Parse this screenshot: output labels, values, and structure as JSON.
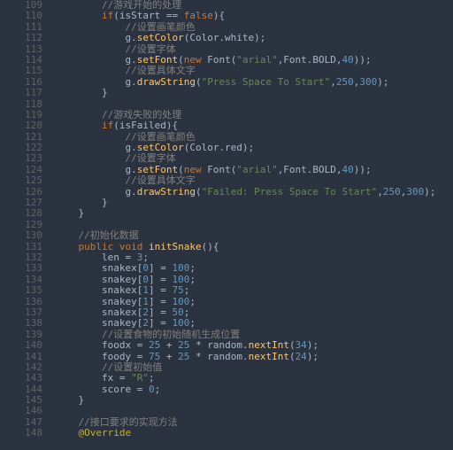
{
  "startLine": 109,
  "lines": [
    {
      "segs": [
        {
          "t": "        ",
          "c": "id"
        },
        {
          "t": "//游戏开始的处理",
          "c": "cm"
        }
      ]
    },
    {
      "segs": [
        {
          "t": "        ",
          "c": "id"
        },
        {
          "t": "if",
          "c": "kw"
        },
        {
          "t": "(isStart == ",
          "c": "id"
        },
        {
          "t": "false",
          "c": "kw"
        },
        {
          "t": "){",
          "c": "id"
        }
      ]
    },
    {
      "segs": [
        {
          "t": "            ",
          "c": "id"
        },
        {
          "t": "//设置画笔颜色",
          "c": "cm"
        }
      ]
    },
    {
      "segs": [
        {
          "t": "            g.",
          "c": "id"
        },
        {
          "t": "setColor",
          "c": "fn"
        },
        {
          "t": "(Color.white);",
          "c": "id"
        }
      ]
    },
    {
      "segs": [
        {
          "t": "            ",
          "c": "id"
        },
        {
          "t": "//设置字体",
          "c": "cm"
        }
      ]
    },
    {
      "segs": [
        {
          "t": "            g.",
          "c": "id"
        },
        {
          "t": "setFont",
          "c": "fn"
        },
        {
          "t": "(",
          "c": "id"
        },
        {
          "t": "new",
          "c": "kw"
        },
        {
          "t": " Font(",
          "c": "id"
        },
        {
          "t": "\"arial\"",
          "c": "str"
        },
        {
          "t": ",Font.BOLD,",
          "c": "id"
        },
        {
          "t": "40",
          "c": "num"
        },
        {
          "t": "));",
          "c": "id"
        }
      ]
    },
    {
      "segs": [
        {
          "t": "            ",
          "c": "id"
        },
        {
          "t": "//设置具体文字",
          "c": "cm"
        }
      ]
    },
    {
      "segs": [
        {
          "t": "            g.",
          "c": "id"
        },
        {
          "t": "drawString",
          "c": "fn"
        },
        {
          "t": "(",
          "c": "id"
        },
        {
          "t": "\"Press Space To Start\"",
          "c": "str"
        },
        {
          "t": ",",
          "c": "id"
        },
        {
          "t": "250",
          "c": "num"
        },
        {
          "t": ",",
          "c": "id"
        },
        {
          "t": "300",
          "c": "num"
        },
        {
          "t": ");",
          "c": "id"
        }
      ]
    },
    {
      "segs": [
        {
          "t": "        }",
          "c": "id"
        }
      ]
    },
    {
      "segs": [
        {
          "t": "",
          "c": "id"
        }
      ]
    },
    {
      "segs": [
        {
          "t": "        ",
          "c": "id"
        },
        {
          "t": "//游戏失败的处理",
          "c": "cm"
        }
      ]
    },
    {
      "segs": [
        {
          "t": "        ",
          "c": "id"
        },
        {
          "t": "if",
          "c": "kw"
        },
        {
          "t": "(isFailed){",
          "c": "id"
        }
      ]
    },
    {
      "segs": [
        {
          "t": "            ",
          "c": "id"
        },
        {
          "t": "//设置画笔颜色",
          "c": "cm"
        }
      ]
    },
    {
      "segs": [
        {
          "t": "            g.",
          "c": "id"
        },
        {
          "t": "setColor",
          "c": "fn"
        },
        {
          "t": "(Color.red);",
          "c": "id"
        }
      ]
    },
    {
      "segs": [
        {
          "t": "            ",
          "c": "id"
        },
        {
          "t": "//设置字体",
          "c": "cm"
        }
      ]
    },
    {
      "segs": [
        {
          "t": "            g.",
          "c": "id"
        },
        {
          "t": "setFont",
          "c": "fn"
        },
        {
          "t": "(",
          "c": "id"
        },
        {
          "t": "new",
          "c": "kw"
        },
        {
          "t": " Font(",
          "c": "id"
        },
        {
          "t": "\"arial\"",
          "c": "str"
        },
        {
          "t": ",Font.BOLD,",
          "c": "id"
        },
        {
          "t": "40",
          "c": "num"
        },
        {
          "t": "));",
          "c": "id"
        }
      ]
    },
    {
      "segs": [
        {
          "t": "            ",
          "c": "id"
        },
        {
          "t": "//设置具体文字",
          "c": "cm"
        }
      ]
    },
    {
      "segs": [
        {
          "t": "            g.",
          "c": "id"
        },
        {
          "t": "drawString",
          "c": "fn"
        },
        {
          "t": "(",
          "c": "id"
        },
        {
          "t": "\"Failed: Press Space To Start\"",
          "c": "str"
        },
        {
          "t": ",",
          "c": "id"
        },
        {
          "t": "250",
          "c": "num"
        },
        {
          "t": ",",
          "c": "id"
        },
        {
          "t": "300",
          "c": "num"
        },
        {
          "t": ");",
          "c": "id"
        }
      ]
    },
    {
      "segs": [
        {
          "t": "        }",
          "c": "id"
        }
      ]
    },
    {
      "segs": [
        {
          "t": "    }",
          "c": "id"
        }
      ]
    },
    {
      "segs": [
        {
          "t": "",
          "c": "id"
        }
      ]
    },
    {
      "segs": [
        {
          "t": "    ",
          "c": "id"
        },
        {
          "t": "//初始化数据",
          "c": "cm"
        }
      ]
    },
    {
      "segs": [
        {
          "t": "    ",
          "c": "id"
        },
        {
          "t": "public void",
          "c": "kw"
        },
        {
          "t": " ",
          "c": "id"
        },
        {
          "t": "initSnake",
          "c": "fn"
        },
        {
          "t": "(){",
          "c": "id"
        }
      ]
    },
    {
      "segs": [
        {
          "t": "        len = ",
          "c": "id"
        },
        {
          "t": "3",
          "c": "num"
        },
        {
          "t": ";",
          "c": "id"
        }
      ]
    },
    {
      "segs": [
        {
          "t": "        snakex[",
          "c": "id"
        },
        {
          "t": "0",
          "c": "num"
        },
        {
          "t": "] = ",
          "c": "id"
        },
        {
          "t": "100",
          "c": "num"
        },
        {
          "t": ";",
          "c": "id"
        }
      ]
    },
    {
      "segs": [
        {
          "t": "        snakey[",
          "c": "id"
        },
        {
          "t": "0",
          "c": "num"
        },
        {
          "t": "] = ",
          "c": "id"
        },
        {
          "t": "100",
          "c": "num"
        },
        {
          "t": ";",
          "c": "id"
        }
      ]
    },
    {
      "segs": [
        {
          "t": "        snakex[",
          "c": "id"
        },
        {
          "t": "1",
          "c": "num"
        },
        {
          "t": "] = ",
          "c": "id"
        },
        {
          "t": "75",
          "c": "num"
        },
        {
          "t": ";",
          "c": "id"
        }
      ]
    },
    {
      "segs": [
        {
          "t": "        snakey[",
          "c": "id"
        },
        {
          "t": "1",
          "c": "num"
        },
        {
          "t": "] = ",
          "c": "id"
        },
        {
          "t": "100",
          "c": "num"
        },
        {
          "t": ";",
          "c": "id"
        }
      ]
    },
    {
      "segs": [
        {
          "t": "        snakex[",
          "c": "id"
        },
        {
          "t": "2",
          "c": "num"
        },
        {
          "t": "] = ",
          "c": "id"
        },
        {
          "t": "50",
          "c": "num"
        },
        {
          "t": ";",
          "c": "id"
        }
      ]
    },
    {
      "segs": [
        {
          "t": "        snakey[",
          "c": "id"
        },
        {
          "t": "2",
          "c": "num"
        },
        {
          "t": "] = ",
          "c": "id"
        },
        {
          "t": "100",
          "c": "num"
        },
        {
          "t": ";",
          "c": "id"
        }
      ]
    },
    {
      "segs": [
        {
          "t": "        ",
          "c": "id"
        },
        {
          "t": "//设置食物的初始随机生成位置",
          "c": "cm"
        }
      ]
    },
    {
      "segs": [
        {
          "t": "        foodx = ",
          "c": "id"
        },
        {
          "t": "25",
          "c": "num"
        },
        {
          "t": " + ",
          "c": "id"
        },
        {
          "t": "25",
          "c": "num"
        },
        {
          "t": " * random.",
          "c": "id"
        },
        {
          "t": "nextInt",
          "c": "fn"
        },
        {
          "t": "(",
          "c": "id"
        },
        {
          "t": "34",
          "c": "num"
        },
        {
          "t": ");",
          "c": "id"
        }
      ]
    },
    {
      "segs": [
        {
          "t": "        foody = ",
          "c": "id"
        },
        {
          "t": "75",
          "c": "num"
        },
        {
          "t": " + ",
          "c": "id"
        },
        {
          "t": "25",
          "c": "num"
        },
        {
          "t": " * random.",
          "c": "id"
        },
        {
          "t": "nextInt",
          "c": "fn"
        },
        {
          "t": "(",
          "c": "id"
        },
        {
          "t": "24",
          "c": "num"
        },
        {
          "t": ");",
          "c": "id"
        }
      ]
    },
    {
      "segs": [
        {
          "t": "        ",
          "c": "id"
        },
        {
          "t": "//设置初始值",
          "c": "cm"
        }
      ]
    },
    {
      "segs": [
        {
          "t": "        fx = ",
          "c": "id"
        },
        {
          "t": "\"R\"",
          "c": "str"
        },
        {
          "t": ";",
          "c": "id"
        }
      ]
    },
    {
      "segs": [
        {
          "t": "        score = ",
          "c": "id"
        },
        {
          "t": "0",
          "c": "num"
        },
        {
          "t": ";",
          "c": "id"
        }
      ]
    },
    {
      "segs": [
        {
          "t": "    }",
          "c": "id"
        }
      ]
    },
    {
      "segs": [
        {
          "t": "",
          "c": "id"
        }
      ]
    },
    {
      "segs": [
        {
          "t": "    ",
          "c": "id"
        },
        {
          "t": "//接口要求的实现方法",
          "c": "cm"
        }
      ]
    },
    {
      "segs": [
        {
          "t": "    ",
          "c": "id"
        },
        {
          "t": "@Override",
          "c": "ann"
        }
      ]
    }
  ]
}
